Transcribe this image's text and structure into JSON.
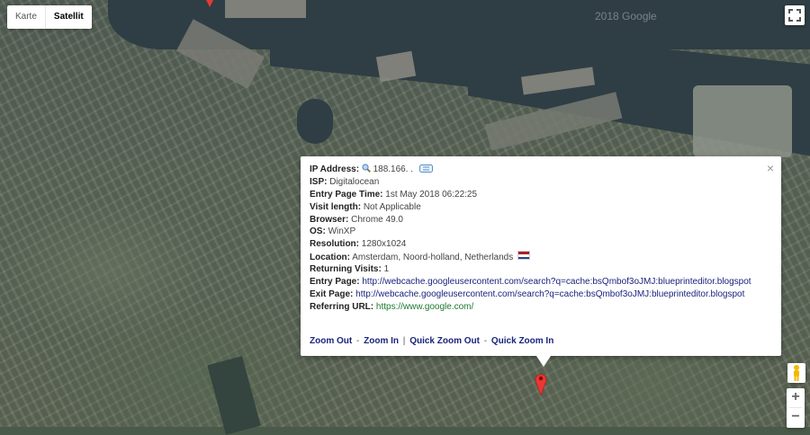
{
  "map": {
    "watermark": "2018 Google",
    "type_control": {
      "map_label": "Karte",
      "satellite_label": "Satellit",
      "active": "Satellit"
    }
  },
  "controls": {
    "zoom_in": "+",
    "zoom_out": "−"
  },
  "info_window": {
    "rows": [
      {
        "label": "IP Address:",
        "value": "188.166.   .   "
      },
      {
        "label": "ISP:",
        "value": "Digitalocean"
      },
      {
        "label": "Entry Page Time:",
        "value": "1st May 2018 06:22:25"
      },
      {
        "label": "Visit length:",
        "value": "Not Applicable"
      },
      {
        "label": "Browser:",
        "value": "Chrome 49.0"
      },
      {
        "label": "OS:",
        "value": "WinXP"
      },
      {
        "label": "Resolution:",
        "value": "1280x1024"
      },
      {
        "label": "Location:",
        "value": "Amsterdam, Noord-holland, Netherlands"
      },
      {
        "label": "Returning Visits:",
        "value": "1"
      },
      {
        "label": "Entry Page:",
        "value": "http://webcache.googleusercontent.com/search?q=cache:bsQmbof3oJMJ:blueprinteditor.blogspot"
      },
      {
        "label": "Exit Page:",
        "value": "http://webcache.googleusercontent.com/search?q=cache:bsQmbof3oJMJ:blueprinteditor.blogspot"
      },
      {
        "label": "Referring URL:",
        "value": "https://www.google.com/"
      }
    ],
    "actions": {
      "zoom_out": "Zoom Out",
      "zoom_in": "Zoom In",
      "quick_zoom_out": "Quick Zoom Out",
      "quick_zoom_in": "Quick Zoom In",
      "sep1": "-",
      "sep2": "|",
      "sep3": "-"
    },
    "close": "×"
  },
  "colors": {
    "link": "#1a237e",
    "referrer_link": "#1b7a2e",
    "marker": "#e53935",
    "flag": [
      "#ae1c28",
      "#ffffff",
      "#21468b"
    ]
  },
  "icons": [
    "magnifier-icon",
    "ip-tag-icon",
    "netherlands-flag-icon",
    "close-icon",
    "fullscreen-icon",
    "pegman-icon",
    "map-marker-icon"
  ]
}
